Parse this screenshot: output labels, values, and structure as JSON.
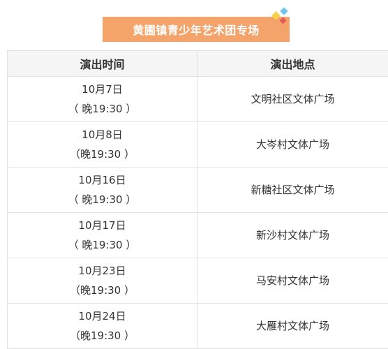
{
  "title": "黄圃镇青少年艺术团专场",
  "table": {
    "headers": {
      "time": "演出时间",
      "place": "演出地点"
    },
    "rows": [
      {
        "date": "10月7日",
        "time": "（ 晚19:30 ）",
        "place": "文明社区文体广场"
      },
      {
        "date": "10月8日",
        "time": "（晚19:30 ）",
        "place": "大岑村文体广场"
      },
      {
        "date": "10月16日",
        "time": "（ 晚19:30 ）",
        "place": "新糖社区文体广场"
      },
      {
        "date": "10月17日",
        "time": "（ 晚19:30 ）",
        "place": "新沙村文体广场"
      },
      {
        "date": "10月23日",
        "time": "（晚19:30 ）",
        "place": "马安村文体广场"
      },
      {
        "date": "10月24日",
        "time": "（晚19:30 ）",
        "place": "大雁村文体广场"
      }
    ]
  },
  "colors": {
    "banner": "#f4a46a",
    "border": "#e2e2e2",
    "header_bg": "#f5f5f5",
    "deco_yellow": "#f7d04a",
    "deco_blue": "#6ec6e8",
    "deco_red": "#e85a5a"
  }
}
